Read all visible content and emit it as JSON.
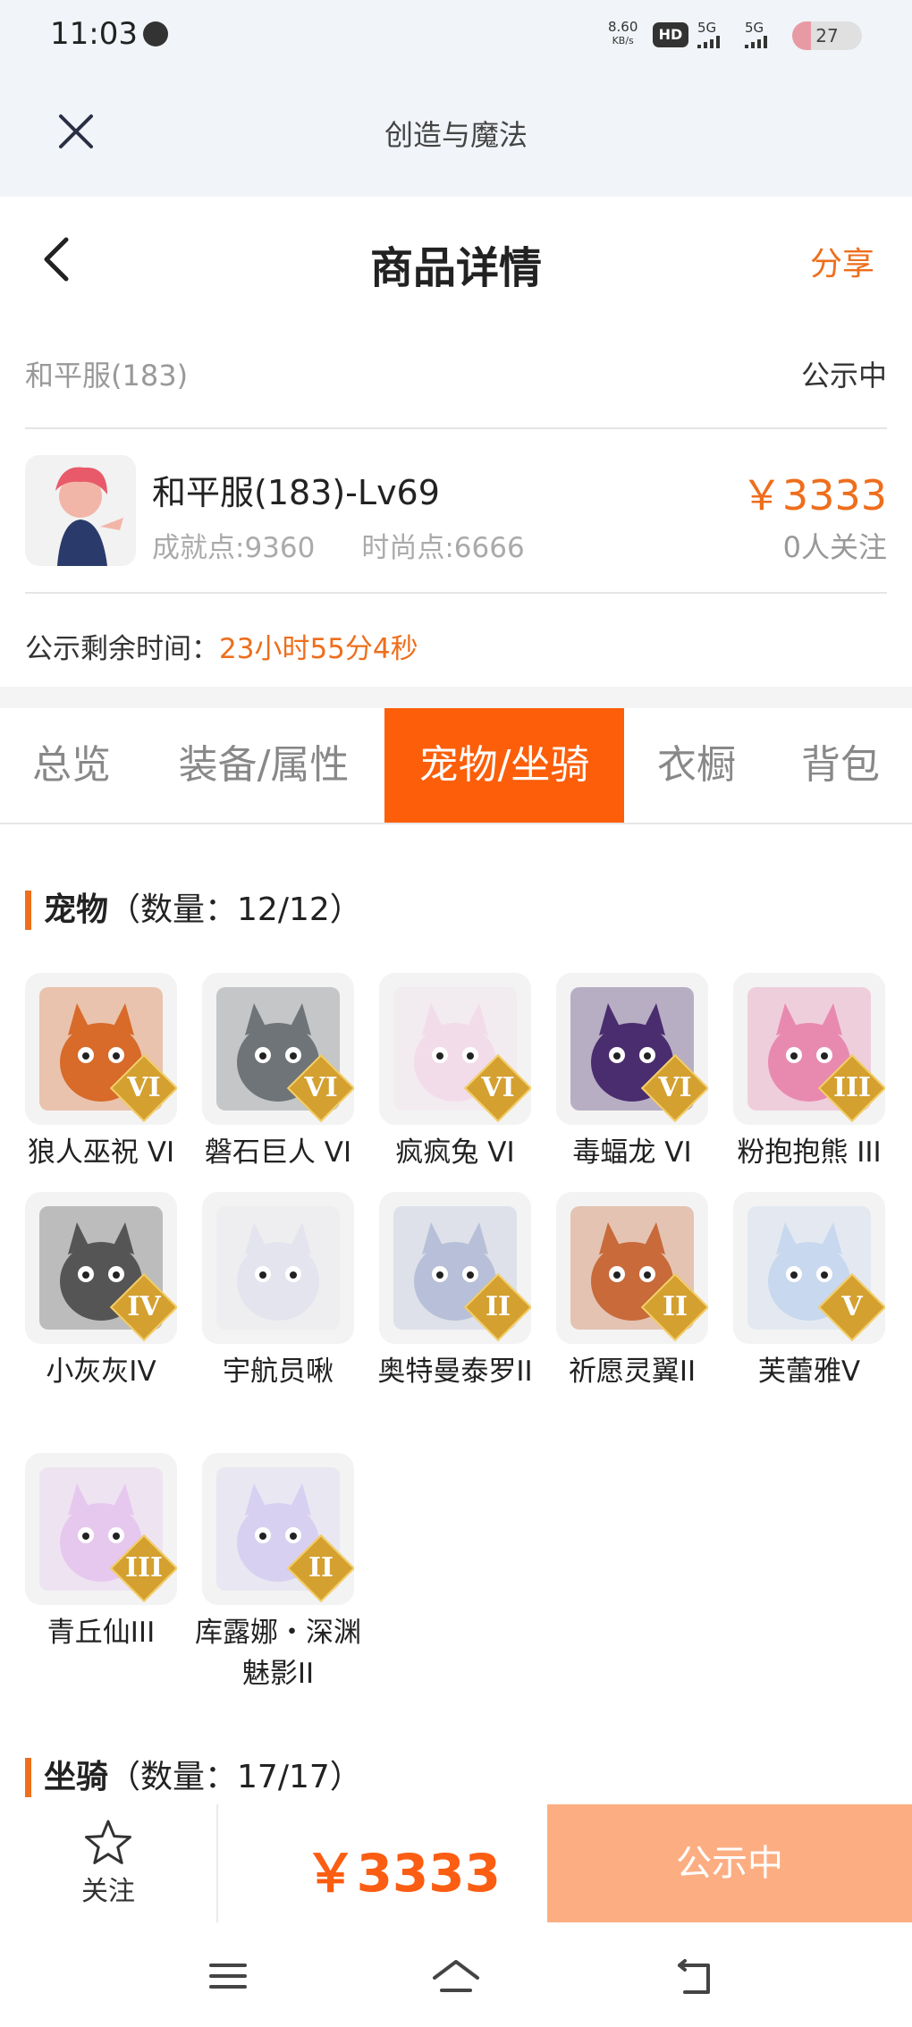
{
  "status_bar": {
    "time": "11:03",
    "net_speed_value": "8.60",
    "net_speed_unit": "KB/s",
    "hd": "HD",
    "signal1": "5G",
    "signal2": "5G",
    "battery": "27",
    "battery_level": 0.27
  },
  "webview": {
    "title": "创造与魔法"
  },
  "nav": {
    "title": "商品详情",
    "share": "分享"
  },
  "listing": {
    "server": "和平服(183)",
    "status": "公示中",
    "item_name": "和平服(183)-Lv69",
    "achievement": "成就点:9360",
    "fashion": "时尚点:6666",
    "price": "￥3333",
    "followers": "0人关注",
    "countdown_label": "公示剩余时间：",
    "countdown_value": "23小时55分4秒"
  },
  "tabs": [
    {
      "label": "总览"
    },
    {
      "label": "装备/属性"
    },
    {
      "label": "宠物/坐骑",
      "active": true
    },
    {
      "label": "衣橱"
    },
    {
      "label": "背包"
    }
  ],
  "pets_section": {
    "title": "宠物",
    "count": "（数量：12/12）"
  },
  "pets": [
    {
      "name": "狼人巫祝 VI",
      "grade": "VI",
      "color": "#d86a2a"
    },
    {
      "name": "磐石巨人 VI",
      "grade": "VI",
      "color": "#6e7478"
    },
    {
      "name": "疯疯兔 VI",
      "grade": "VI",
      "color": "#f2dcea"
    },
    {
      "name": "毒蝠龙 VI",
      "grade": "VI",
      "color": "#4a2d6e"
    },
    {
      "name": "粉抱抱熊 III",
      "grade": "III",
      "color": "#e88ab0"
    },
    {
      "name": "小灰灰IV",
      "grade": "IV",
      "color": "#555555"
    },
    {
      "name": "宇航员啾",
      "grade": "",
      "color": "#e4e4ee"
    },
    {
      "name": "奥特曼泰罗II",
      "grade": "II",
      "color": "#b7c0d8"
    },
    {
      "name": "祈愿灵翼II",
      "grade": "II",
      "color": "#c86a3a"
    },
    {
      "name": "芙蕾雅V",
      "grade": "V",
      "color": "#c8d8ee"
    },
    {
      "name": "青丘仙III",
      "grade": "III",
      "color": "#e6c8ee"
    },
    {
      "name": "库露娜・深渊魅影II",
      "grade": "II",
      "color": "#d8d0f0"
    }
  ],
  "mounts_section": {
    "title": "坐骑",
    "count": "（数量：17/17）"
  },
  "bottom_bar": {
    "follow": "关注",
    "price": "￥3333",
    "action": "公示中"
  }
}
